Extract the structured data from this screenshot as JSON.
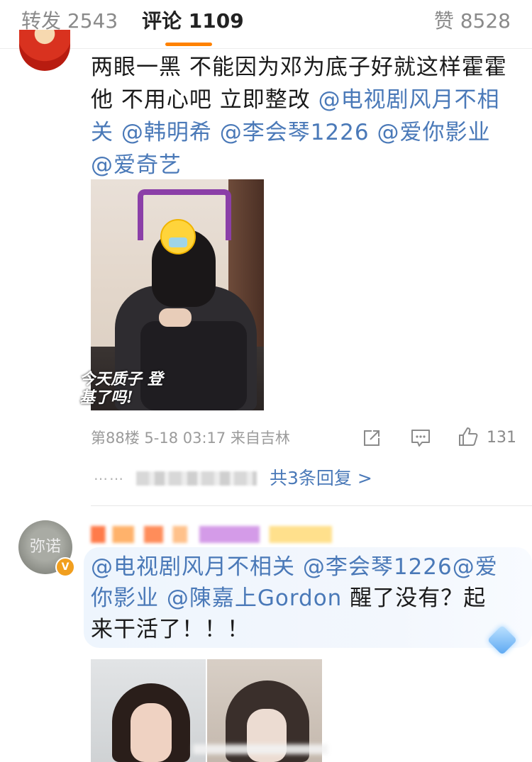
{
  "tabs": {
    "repost": "转发 2543",
    "comment": "评论 1109",
    "like": "赞 8528"
  },
  "comment1": {
    "line1": "两眼一黑 不能因为邓为底子好就这样霍霍",
    "line2_plain": "他 不用心吧  立即整改 ",
    "mentions": [
      "@电视剧风月不相",
      "关 @韩明希 @李会琴1226 @爱你影业",
      "@爱奇艺"
    ],
    "photo_caption": "今天质子 登基了吗!",
    "meta": "第88楼 5-18 03:17 来自吉林",
    "likes": "131",
    "reply_dots": "……",
    "reply_link": "共3条回复 >"
  },
  "comment2": {
    "avatar_text": "弥诺",
    "badge": "V",
    "mentions_line1": "@电视剧风月不相关 @李会琴1226@爱",
    "mentions_line2": "你影业 @陳嘉上Gordon",
    "text_line2_tail": " 醒了没有？起",
    "text_line3": "来干活了！！！"
  },
  "colors": {
    "accent_orange": "#ff8200",
    "mention_blue": "#4a79b8",
    "meta_gray": "#9b9b9b"
  },
  "icons": [
    "share-icon",
    "comment-icon",
    "like-icon",
    "diamond-icon",
    "verified-badge-icon"
  ]
}
